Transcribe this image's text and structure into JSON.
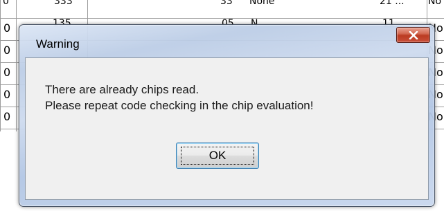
{
  "background_table": {
    "top_row_partial": [
      "0",
      "333",
      "33",
      "None",
      "21 ...",
      "No"
    ],
    "left_column": [
      "0",
      "0",
      "0",
      "0",
      "0"
    ],
    "second_row_partial": [
      "135",
      "05",
      "N",
      "11",
      "No"
    ],
    "right_column": [
      "No",
      "No",
      "No",
      "No",
      "No"
    ]
  },
  "dialog": {
    "title": "Warning",
    "close_icon": "close-x-icon",
    "message_lines": [
      "There are already chips read.",
      "Please repeat code checking in the chip evaluation!"
    ],
    "ok_label": "OK",
    "colors": {
      "frame": "#bccde6",
      "close_button": "#c9503a",
      "client": "#f0f0f0",
      "button_border": "#3c7fb1"
    }
  }
}
